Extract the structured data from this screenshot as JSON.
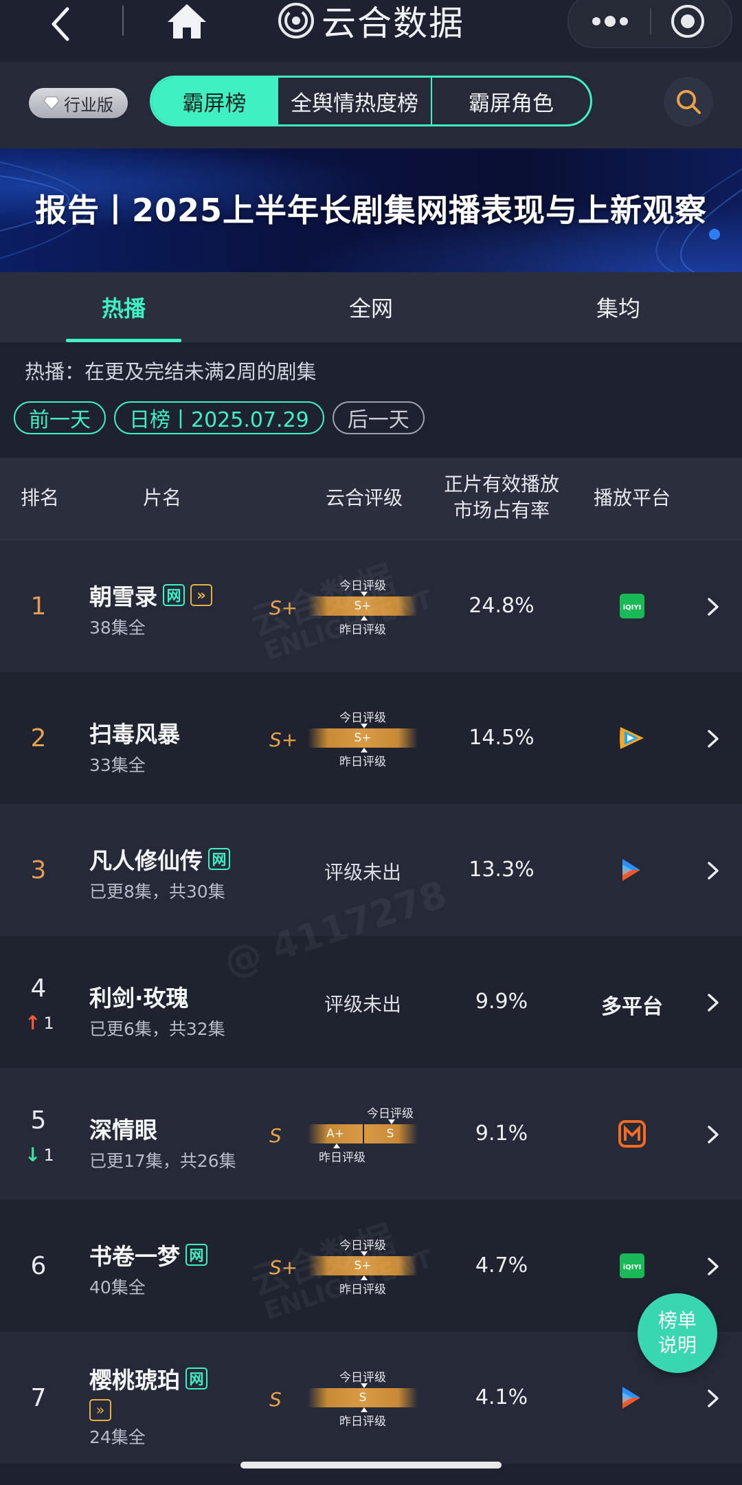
{
  "app": {
    "brand": "云合数据"
  },
  "filter": {
    "industry_label": "行业版",
    "segments": [
      "霸屏榜",
      "全舆情热度榜",
      "霸屏角色"
    ]
  },
  "banner": {
    "title": "报告丨2025上半年长剧集网播表现与上新观察"
  },
  "tabs": [
    "热播",
    "全网",
    "集均"
  ],
  "note": "热播：在更及完结未满2周的剧集",
  "dates": {
    "prev": "前一天",
    "current": "日榜丨2025.07.29",
    "next": "后一天"
  },
  "table": {
    "headers": {
      "rank": "排名",
      "title": "片名",
      "rating": "云合评级",
      "share_l1": "正片有效播放",
      "share_l2": "市场占有率",
      "platform": "播放平台"
    },
    "rating_today_label": "今日评级",
    "rating_yesterday_label": "昨日评级",
    "rows": [
      {
        "rank": "1",
        "title": "朝雪录",
        "badges": [
          "网",
          "vip"
        ],
        "episodes": "38集全",
        "grade": "S+",
        "today": "S+",
        "share": "24.8%",
        "platform": "iqiyi"
      },
      {
        "rank": "2",
        "title": "扫毒风暴",
        "badges": [],
        "episodes": "33集全",
        "grade": "S+",
        "today": "S+",
        "share": "14.5%",
        "platform": "tencent"
      },
      {
        "rank": "3",
        "title": "凡人修仙传",
        "badges": [
          "网"
        ],
        "episodes": "已更8集，共30集",
        "no_grade": "评级未出",
        "share": "13.3%",
        "platform": "youku"
      },
      {
        "rank": "4",
        "delta": "1",
        "delta_dir": "up",
        "title": "利剑·玫瑰",
        "badges": [],
        "episodes": "已更6集，共32集",
        "no_grade": "评级未出",
        "share": "9.9%",
        "platform_text": "多平台"
      },
      {
        "rank": "5",
        "delta": "1",
        "delta_dir": "down",
        "title": "深情眼",
        "badges": [],
        "episodes": "已更17集，共26集",
        "grade": "S",
        "yesterday": "A+",
        "today": "S",
        "share": "9.1%",
        "platform": "mango"
      },
      {
        "rank": "6",
        "title": "书卷一梦",
        "badges": [
          "网"
        ],
        "episodes": "40集全",
        "grade": "S+",
        "today": "S+",
        "share": "4.7%",
        "platform": "iqiyi"
      },
      {
        "rank": "7",
        "title": "樱桃琥珀",
        "badges": [
          "网",
          "vip"
        ],
        "episodes": "24集全",
        "grade": "S",
        "today": "S",
        "share": "4.1%",
        "platform": "youku"
      }
    ]
  },
  "float_button": {
    "line1": "榜单",
    "line2": "说明"
  },
  "watermarks": {
    "brand": "云合数据",
    "brand_en": "ENLIGHTENT",
    "user": "@ 4117278"
  },
  "colors": {
    "accent": "#3ff0c3",
    "grade": "#e7a24a",
    "bg": "#1e2230"
  }
}
